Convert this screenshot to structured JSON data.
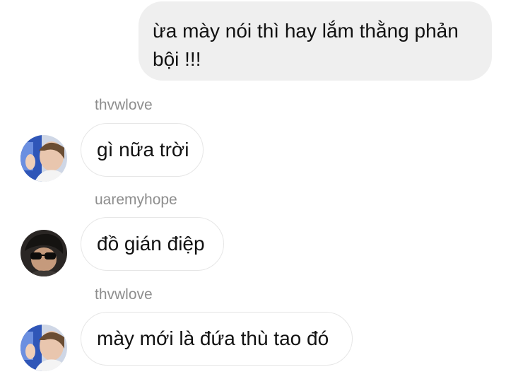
{
  "outgoing": {
    "text": "ừa mày nói thì hay lắm thằng phản bội !!!"
  },
  "messages": [
    {
      "sender": "thvwlove",
      "text": "gì nữa trời",
      "avatar": "user-photo-avatar"
    },
    {
      "sender": "uaremyhope",
      "text": "đồ gián điệp",
      "avatar": "user-photo-avatar"
    },
    {
      "sender": "thvwlove",
      "text": "mày mới là đứa thù tao đó",
      "avatar": "user-photo-avatar"
    }
  ],
  "colors": {
    "outgoing_bubble": "#efefef",
    "incoming_border": "#e6e6e6",
    "sender_text": "#8e8e8e",
    "message_text": "#111111"
  }
}
